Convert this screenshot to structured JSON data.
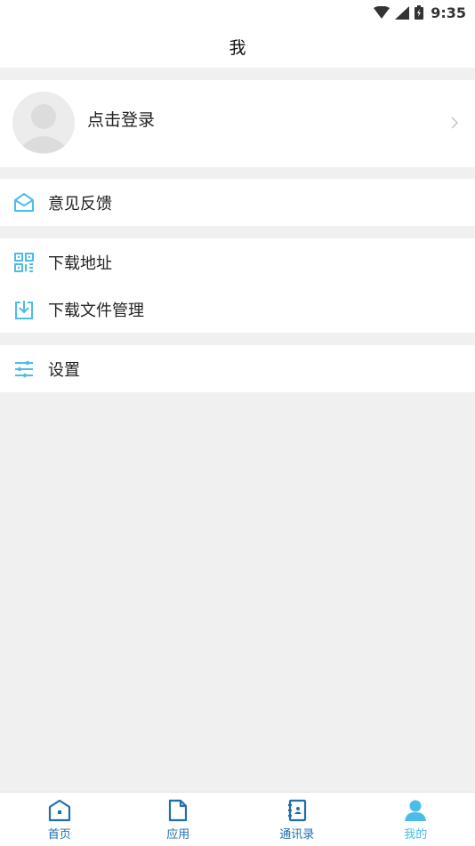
{
  "status_bar": {
    "time": "9:35"
  },
  "header": {
    "title": "我"
  },
  "login": {
    "label": "点击登录"
  },
  "menu": {
    "feedback": {
      "label": "意见反馈"
    },
    "download_address": {
      "label": "下载地址"
    },
    "download_files": {
      "label": "下载文件管理"
    },
    "settings": {
      "label": "设置"
    }
  },
  "bottom_nav": {
    "home": {
      "label": "首页"
    },
    "apps": {
      "label": "应用"
    },
    "contacts": {
      "label": "通讯录"
    },
    "mine": {
      "label": "我的"
    }
  },
  "colors": {
    "accent": "#4bbde9",
    "nav_icon": "#1f6fad",
    "background": "#f0f0f0"
  }
}
